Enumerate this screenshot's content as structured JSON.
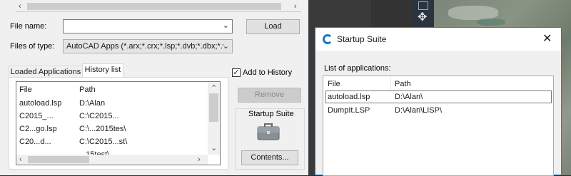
{
  "load_dialog": {
    "file_name_label": "File name:",
    "file_name_value": "",
    "load_button": "Load",
    "files_of_type_label": "Files of type:",
    "files_of_type_value": "AutoCAD Apps (*.arx;*.crx;*.lsp;*.dvb;*.dbx;*.vlx;*",
    "tabs": [
      {
        "label": "Loaded Applications",
        "active": false
      },
      {
        "label": "History list",
        "active": true
      }
    ],
    "add_to_history_label": "Add to History",
    "add_to_history_checked": true,
    "remove_button": "Remove",
    "startup_suite_label": "Startup Suite",
    "contents_button": "Contents...",
    "history_columns": [
      "File",
      "Path"
    ],
    "history_rows": [
      {
        "file": "autoload.lsp",
        "path": "D:\\Alan"
      },
      {
        "file": "C2015_...",
        "path": "C:\\C2015..."
      },
      {
        "file": "C2...go.lsp",
        "path": "C:\\...2015tes\\"
      },
      {
        "file": "C20...d...",
        "path": "C:\\C2015...st\\"
      },
      {
        "file": "",
        "path": "...15test\\"
      }
    ]
  },
  "startup_suite": {
    "title": "Startup Suite",
    "list_label": "List of applications:",
    "columns": [
      "File",
      "Path"
    ],
    "rows": [
      {
        "file": "autoload.lsp",
        "path": "D:\\Alan\\",
        "selected": true
      },
      {
        "file": "DumpIt.LSP",
        "path": "D:\\Alan\\LISP\\",
        "selected": false
      }
    ]
  },
  "icons": {
    "close": "close-icon",
    "app": "autocad-app-icon",
    "briefcase": "briefcase-icon",
    "move": "pan-move-icon",
    "viewcube": "viewcube-icon"
  },
  "colors": {
    "dialog_bg": "#f0f0f0",
    "accent_border": "#1883d7",
    "disabled_text": "#8a8a8a"
  }
}
